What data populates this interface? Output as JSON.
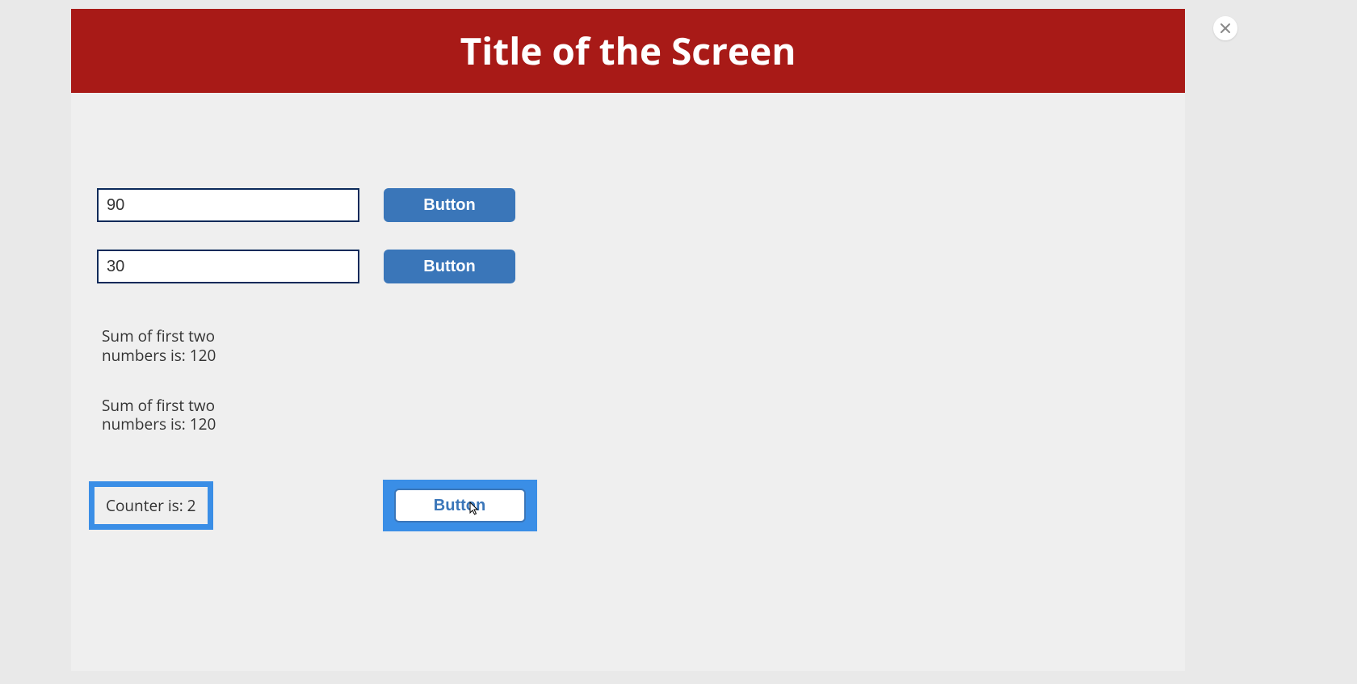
{
  "header": {
    "title": "Title of the Screen"
  },
  "inputs": {
    "first_value": "90",
    "second_value": "30"
  },
  "buttons": {
    "row1_label": "Button",
    "row2_label": "Button",
    "highlighted_label": "Button"
  },
  "sums": {
    "sum1": "Sum of first two numbers is: 120",
    "sum2": "Sum of first two numbers is: 120"
  },
  "counter": {
    "text": "Counter is: 2"
  }
}
